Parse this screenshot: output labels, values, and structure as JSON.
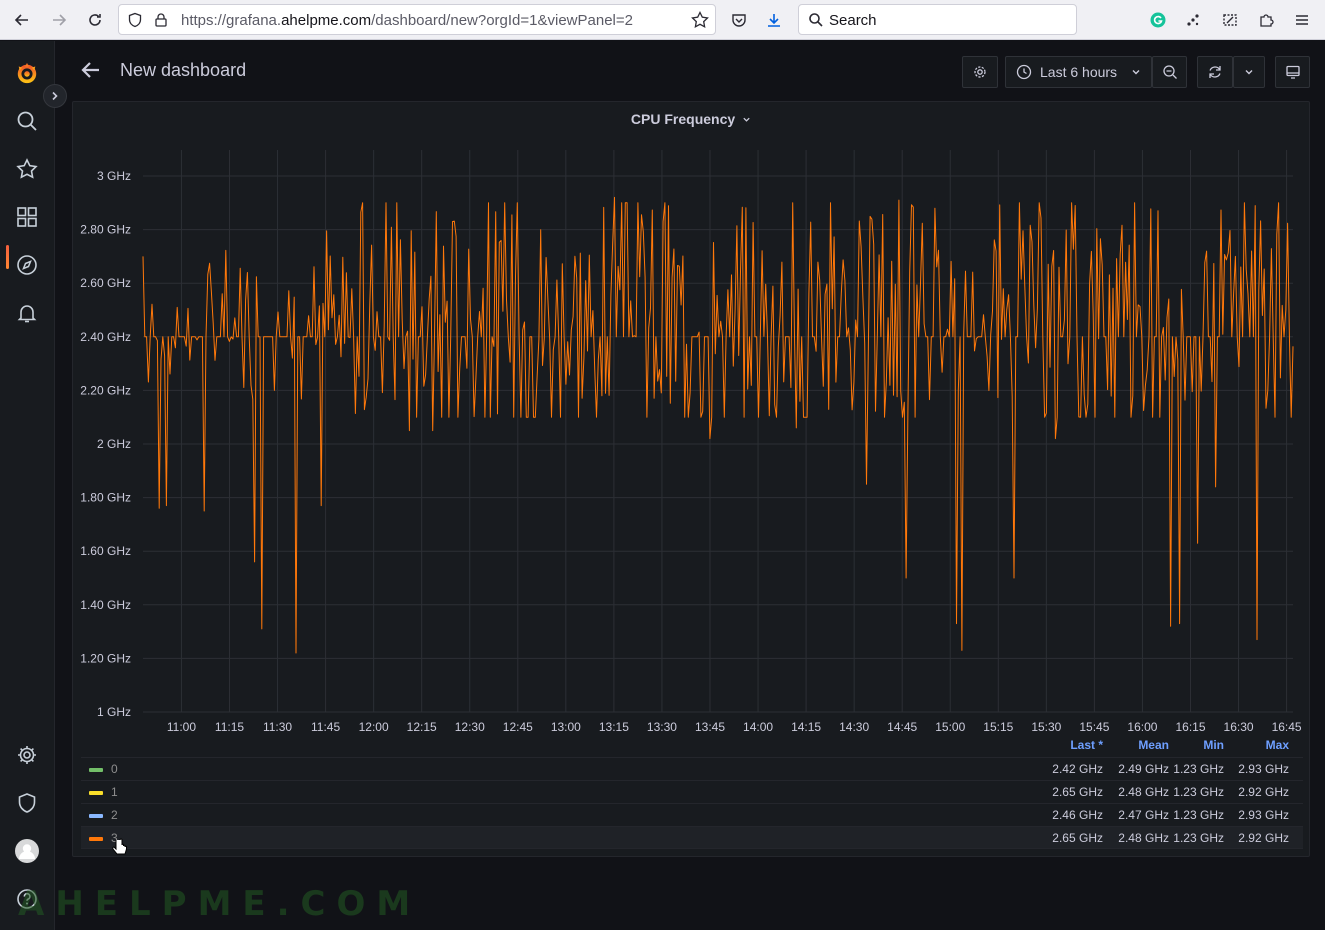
{
  "browser": {
    "url_prefix": "https://grafana.",
    "url_domain": "ahelpme.com",
    "url_path": "/dashboard/new?orgId=1&viewPanel=2",
    "search_placeholder": "Search"
  },
  "sidemenu": {
    "items": [
      "grafana-logo-icon",
      "search-icon",
      "starred-icon",
      "dashboards-icon",
      "explore-icon",
      "alerting-icon",
      "configuration-icon",
      "server-admin-icon",
      "profile-avatar",
      "help-icon"
    ]
  },
  "topbar": {
    "title": "New dashboard",
    "time_range": "Last 6 hours"
  },
  "panel": {
    "title": "CPU Frequency"
  },
  "chart_data": {
    "type": "line",
    "title": "CPU Frequency",
    "ylim": [
      1,
      3.1
    ],
    "y_ticks": [
      "3 GHz",
      "2.80 GHz",
      "2.60 GHz",
      "2.40 GHz",
      "2.20 GHz",
      "2 GHz",
      "1.80 GHz",
      "1.60 GHz",
      "1.40 GHz",
      "1.20 GHz",
      "1 GHz"
    ],
    "y_tick_values": [
      3.0,
      2.8,
      2.6,
      2.4,
      2.2,
      2.0,
      1.8,
      1.6,
      1.4,
      1.2,
      1.0
    ],
    "x_ticks": [
      "11:00",
      "11:15",
      "11:30",
      "11:45",
      "12:00",
      "12:15",
      "12:30",
      "12:45",
      "13:00",
      "13:15",
      "13:30",
      "13:45",
      "14:00",
      "14:15",
      "14:30",
      "14:45",
      "15:00",
      "15:15",
      "15:30",
      "15:45",
      "16:00",
      "16:15",
      "16:30",
      "16:45"
    ],
    "x_range": [
      "10:48",
      "16:47"
    ],
    "baseline": 2.4,
    "dips": [
      [
        10.88,
        1.76
      ],
      [
        10.92,
        1.77
      ],
      [
        11.12,
        1.75
      ],
      [
        11.38,
        1.56
      ],
      [
        11.42,
        1.31
      ],
      [
        11.6,
        1.22
      ],
      [
        11.73,
        1.77
      ],
      [
        12.19,
        2.05
      ],
      [
        12.31,
        2.05
      ],
      [
        12.58,
        2.1
      ],
      [
        13.75,
        2.02
      ],
      [
        14.2,
        2.06
      ],
      [
        14.56,
        1.85
      ],
      [
        14.77,
        1.5
      ],
      [
        15.03,
        1.33
      ],
      [
        15.06,
        1.23
      ],
      [
        15.33,
        1.5
      ],
      [
        15.55,
        2.02
      ],
      [
        16.15,
        1.32
      ],
      [
        16.19,
        1.33
      ],
      [
        16.29,
        1.63
      ],
      [
        16.38,
        1.84
      ],
      [
        16.6,
        1.27
      ]
    ],
    "peaks": [
      [
        12.75,
        2.9
      ],
      [
        13.25,
        2.92
      ],
      [
        14.73,
        2.91
      ],
      [
        14.92,
        2.88
      ],
      [
        15.65,
        2.89
      ],
      [
        16.08,
        2.87
      ],
      [
        16.48,
        2.7
      ],
      [
        16.57,
        2.72
      ]
    ],
    "series": [
      {
        "name": "3",
        "color": "#ff780a"
      }
    ]
  },
  "legend": {
    "headers": [
      "Last *",
      "Mean",
      "Min",
      "Max"
    ],
    "rows": [
      {
        "name": "0",
        "color": "#73bf69",
        "last": "2.42 GHz",
        "mean": "2.49 GHz",
        "min": "1.23 GHz",
        "max": "2.93 GHz"
      },
      {
        "name": "1",
        "color": "#fade2a",
        "last": "2.65 GHz",
        "mean": "2.48 GHz",
        "min": "1.23 GHz",
        "max": "2.92 GHz"
      },
      {
        "name": "2",
        "color": "#8ab8ff",
        "last": "2.46 GHz",
        "mean": "2.47 GHz",
        "min": "1.23 GHz",
        "max": "2.93 GHz"
      },
      {
        "name": "3",
        "color": "#ff780a",
        "last": "2.65 GHz",
        "mean": "2.48 GHz",
        "min": "1.23 GHz",
        "max": "2.92 GHz"
      }
    ]
  },
  "watermark": "AHELPME.COM"
}
